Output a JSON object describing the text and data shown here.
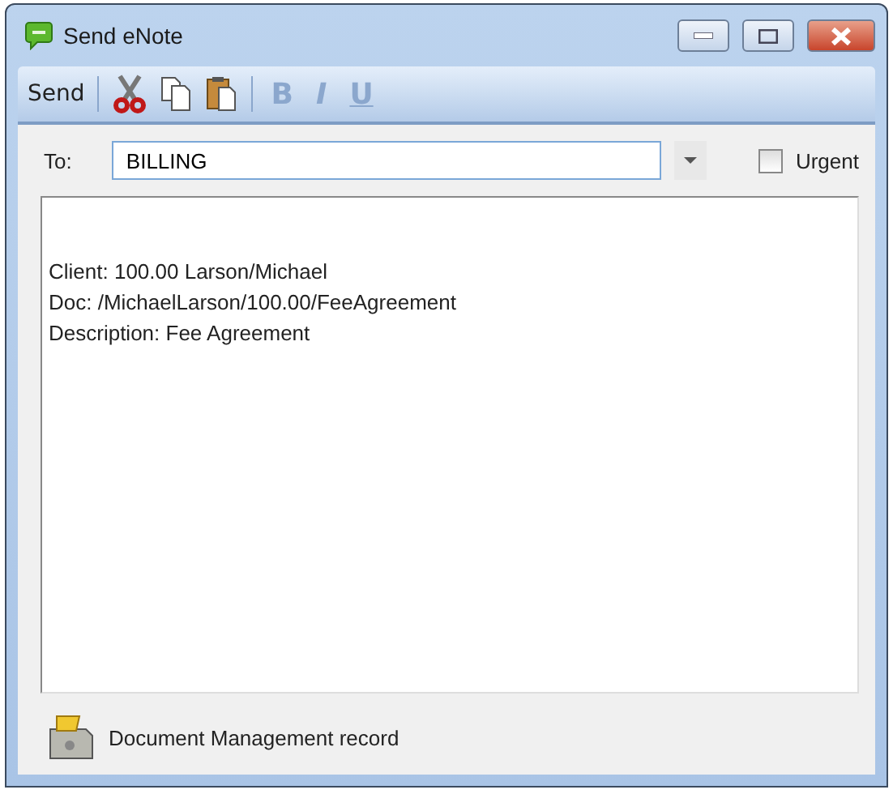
{
  "window": {
    "title": "Send eNote"
  },
  "toolbar": {
    "send": "Send",
    "edit_tools": [
      {
        "kind": "cut"
      },
      {
        "kind": "copy"
      },
      {
        "kind": "paste"
      }
    ],
    "format_tools": [
      {
        "label": "B",
        "kind": "bold",
        "disabled": true
      },
      {
        "label": "I",
        "kind": "italic",
        "disabled": true
      },
      {
        "label": "U",
        "kind": "underline",
        "disabled": true
      }
    ]
  },
  "to": {
    "label": "To:",
    "value": "BILLING"
  },
  "urgent": {
    "label": "Urgent",
    "checked": false
  },
  "message": [
    "Client: 100.00 Larson/Michael",
    "Doc: /MichaelLarson/100.00/FeeAgreement",
    "Description: Fee Agreement"
  ],
  "attachment": {
    "label": "Document Management record"
  }
}
